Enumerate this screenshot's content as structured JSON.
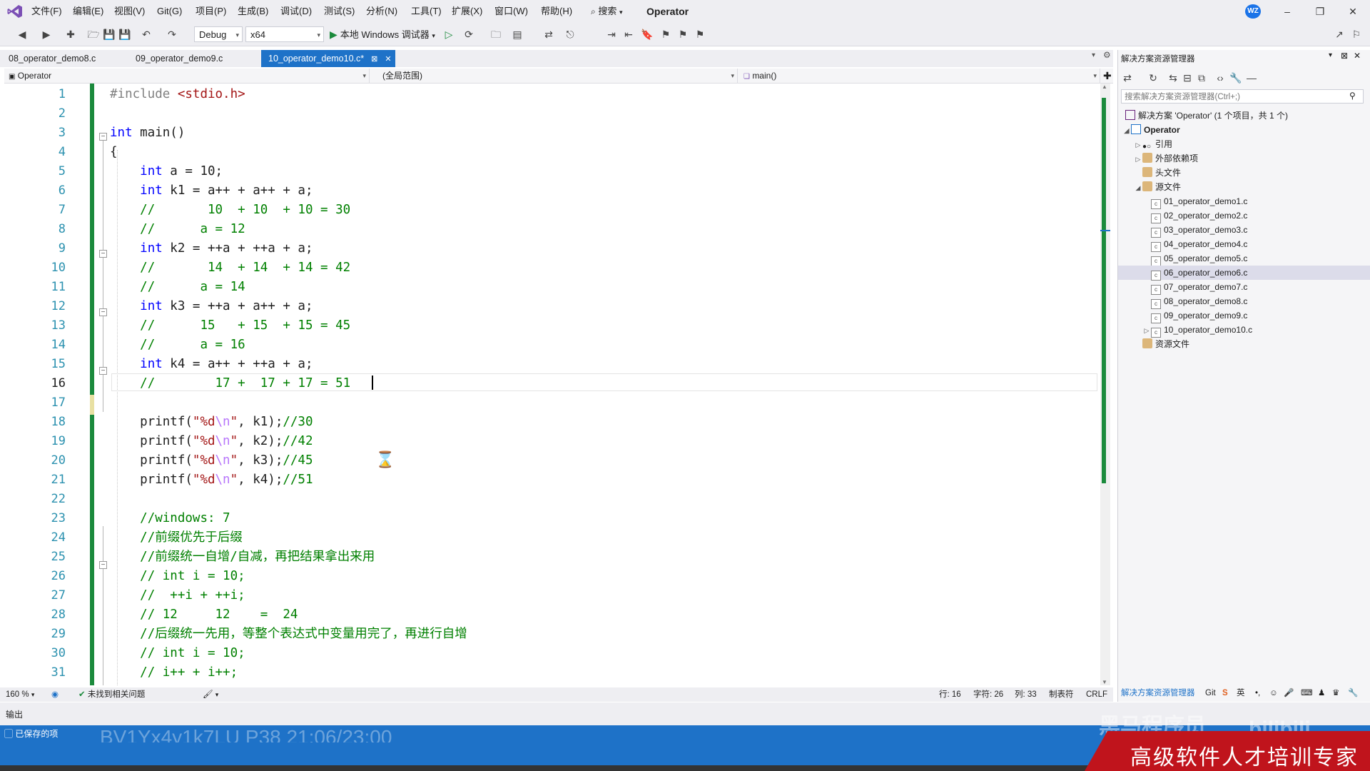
{
  "menubar": {
    "items": [
      "文件(F)",
      "编辑(E)",
      "视图(V)",
      "Git(G)",
      "项目(P)",
      "生成(B)",
      "调试(D)",
      "测试(S)",
      "分析(N)",
      "工具(T)",
      "扩展(X)",
      "窗口(W)",
      "帮助(H)"
    ],
    "search_label": "搜索",
    "title": "Operator",
    "avatar": "WZ"
  },
  "toolbar": {
    "config": "Debug",
    "platform": "x64",
    "run_label": "本地 Windows 调试器"
  },
  "tabs": [
    {
      "label": "08_operator_demo8.c",
      "active": false
    },
    {
      "label": "09_operator_demo9.c",
      "active": false
    },
    {
      "label": "10_operator_demo10.c*",
      "active": true
    }
  ],
  "navbar": {
    "project": "Operator",
    "scope": "(全局范围)",
    "member": "main()"
  },
  "editor": {
    "current_line": 16,
    "lines": [
      "#include <stdio.h>",
      "",
      "int main()",
      "{",
      "    int a = 10;",
      "    int k1 = a++ + a++ + a;",
      "    //       10  + 10  + 10 = 30",
      "    //      a = 12",
      "    int k2 = ++a + ++a + a;",
      "    //       14  + 14  + 14 = 42",
      "    //      a = 14",
      "    int k3 = ++a + a++ + a;",
      "    //      15   + 15  + 15 = 45",
      "    //      a = 16",
      "    int k4 = a++ + ++a + a;",
      "    //        17 +  17 + 17 = 51",
      "",
      "    printf(\"%d\\n\", k1);//30",
      "    printf(\"%d\\n\", k2);//42",
      "    printf(\"%d\\n\", k3);//45",
      "    printf(\"%d\\n\", k4);//51",
      "",
      "    //windows: 7",
      "    //前缀优先于后缀",
      "    //前缀统一自增/自减，再把结果拿出来用",
      "    // int i = 10;",
      "    //  ++i + ++i;",
      "    // 12     12    =  24",
      "    //后缀统一先用，等整个表达式中变量用完了，再进行自增",
      "    // int i = 10;",
      "    // i++ + i++;"
    ]
  },
  "edstatus": {
    "zoom": "160 %",
    "issues": "未找到相关问题",
    "row": "行: 16",
    "char": "字符: 26",
    "col": "列: 33",
    "tabs": "制表符",
    "eol": "CRLF"
  },
  "solution": {
    "title": "解决方案资源管理器",
    "search_placeholder": "搜索解决方案资源管理器(Ctrl+;)",
    "solution_label": "解决方案 'Operator' (1 个项目，共 1 个)",
    "project": "Operator",
    "references": "引用",
    "external_deps": "外部依赖项",
    "headers": "头文件",
    "sources": "源文件",
    "files": [
      "01_operator_demo1.c",
      "02_operator_demo2.c",
      "03_operator_demo3.c",
      "04_operator_demo4.c",
      "05_operator_demo5.c",
      "06_operator_demo6.c",
      "07_operator_demo7.c",
      "08_operator_demo8.c",
      "09_operator_demo9.c",
      "10_operator_demo10.c"
    ],
    "selected_file": "06_operator_demo6.c",
    "resources": "资源文件",
    "bottom_tab": "解决方案资源管理器",
    "git_tab": "Git"
  },
  "output": {
    "label": "输出"
  },
  "statusbar": {
    "saved": "已保存的项",
    "watermark_left": "BV1Yx4y1k7LU P38 21:06/23:00",
    "watermark_right": "黑马程序员",
    "bili": "bilibili"
  },
  "banner": {
    "text": "高级软件人才培训专家"
  },
  "colors": {
    "accent": "#1e72c8",
    "keyword": "#0000ff",
    "comment": "#008000",
    "string": "#a31515",
    "line_number": "#2b91af",
    "change_bar": "#1b8a3c",
    "banner": "#c0141c"
  }
}
